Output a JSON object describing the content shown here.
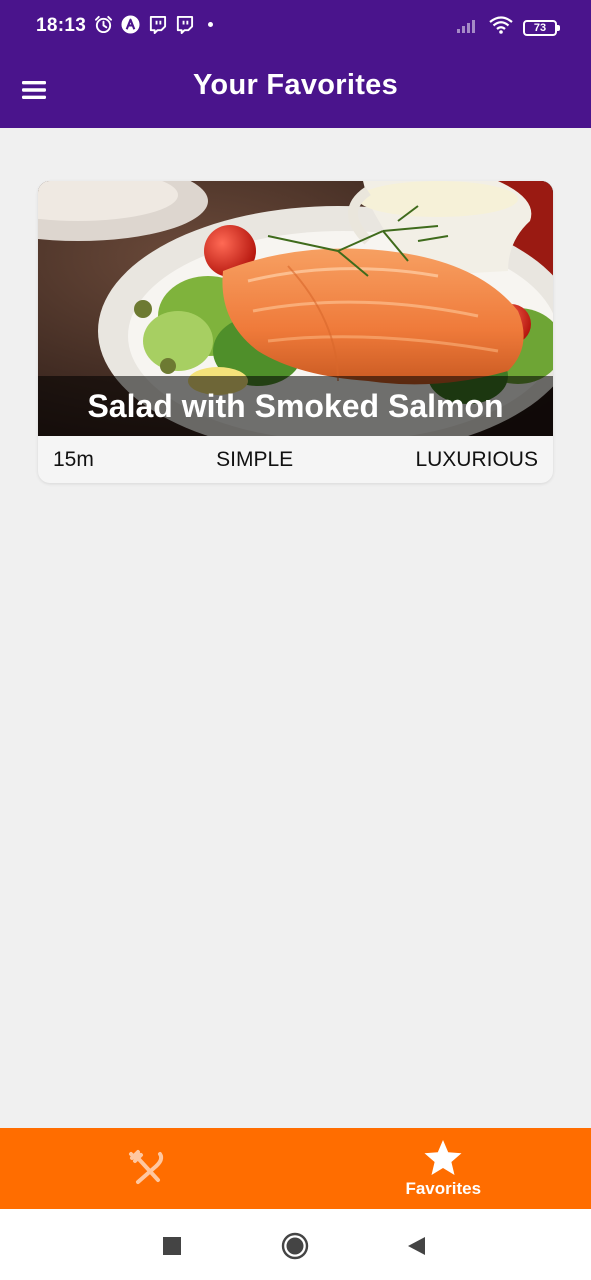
{
  "status_bar": {
    "time": "18:13",
    "battery_level": "73",
    "icons_left": [
      "alarm-icon",
      "a-app-icon",
      "twitch-icon",
      "twitch-icon"
    ],
    "icons_right": [
      "signal-icon",
      "wifi-icon",
      "battery-icon"
    ]
  },
  "app_bar": {
    "title": "Your Favorites",
    "menu_icon": "hamburger-menu-icon",
    "background": "#4a148c"
  },
  "favorites": [
    {
      "title": "Salad with Smoked Salmon",
      "duration": "15m",
      "complexity": "SIMPLE",
      "affordability": "LUXURIOUS"
    }
  ],
  "tab_bar": {
    "background": "#ff6d00",
    "tabs": [
      {
        "icon": "fork-knife-icon",
        "label": "",
        "active": false
      },
      {
        "icon": "star-icon",
        "label": "Favorites",
        "active": true
      }
    ]
  },
  "system_nav": {
    "buttons": [
      "recents-square-icon",
      "home-circle-icon",
      "back-triangle-icon"
    ]
  }
}
